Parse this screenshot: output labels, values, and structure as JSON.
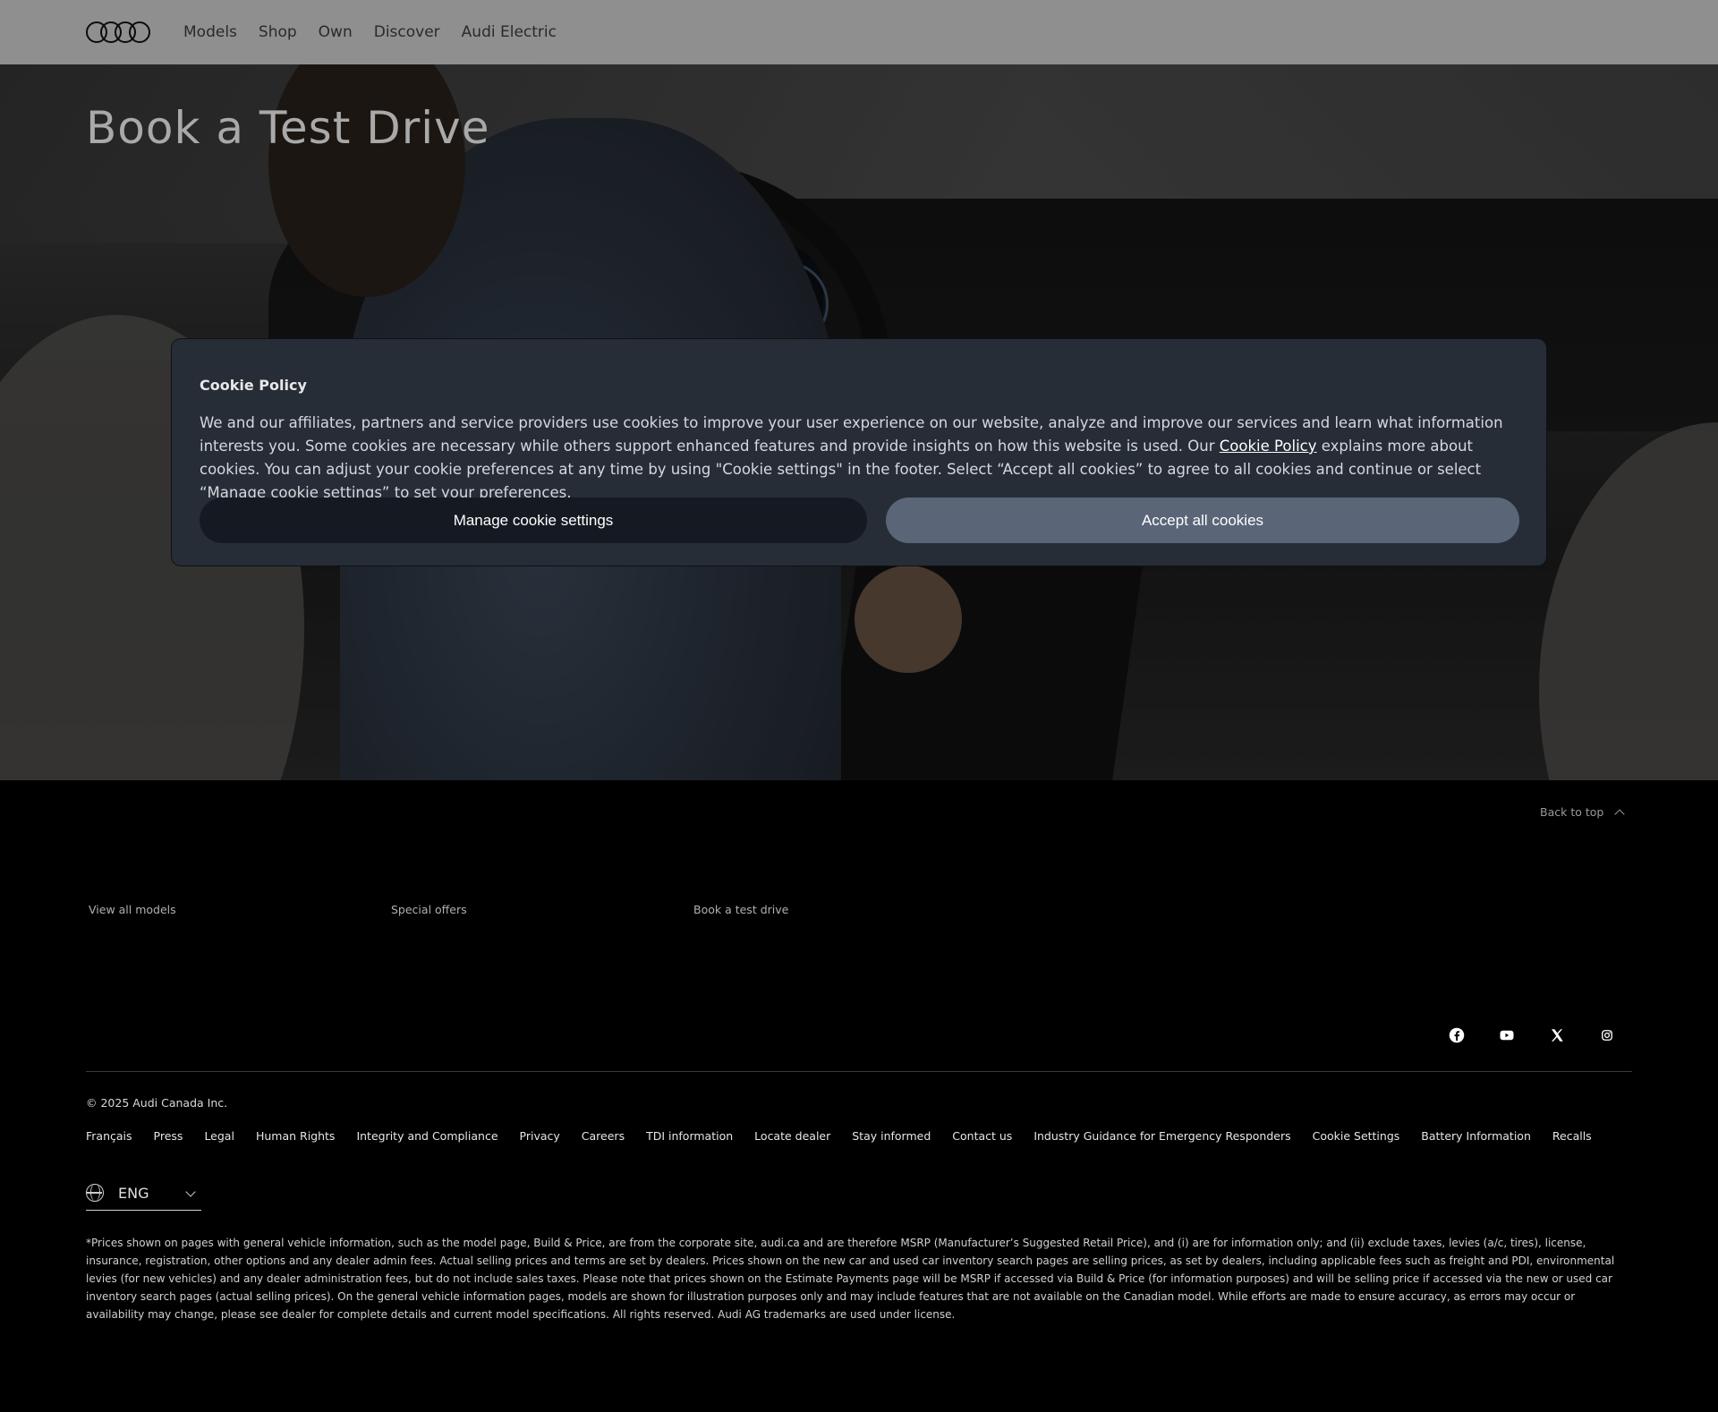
{
  "header": {
    "logo_alt": "Audi",
    "nav": [
      "Models",
      "Shop",
      "Own",
      "Discover",
      "Audi Electric"
    ]
  },
  "hero": {
    "title": "Book a Test Drive"
  },
  "cookie_modal": {
    "title": "Cookie Policy",
    "body_before": "We and our affiliates, partners and service providers use cookies to improve your user experience on our website, analyze and improve our services and learn what information interests you. Some cookies are necessary while others support enhanced features and provide insights on how this website is used. Our ",
    "link": "Cookie Policy",
    "body_after": " explains more about cookies. You can adjust your cookie preferences at any time by using \"Cookie settings\" in the footer. Select “Accept all cookies” to agree to all cookies and continue or select “Manage cookie settings” to set your preferences.",
    "manage_label": "Manage cookie settings",
    "accept_label": "Accept all cookies"
  },
  "footer": {
    "back_to_top": "Back to top",
    "quick_links": [
      "View all models",
      "Special offers",
      "Book a test drive"
    ],
    "social_icons": [
      "facebook-icon",
      "youtube-icon",
      "x-icon",
      "instagram-icon"
    ],
    "copyright": "© 2025 Audi Canada Inc.",
    "links": [
      "Français",
      "Press",
      "Legal",
      "Human Rights",
      "Integrity and Compliance",
      "Privacy",
      "Careers",
      "TDI information",
      "Locate dealer",
      "Stay informed",
      "Contact us",
      "Industry Guidance for Emergency Responders",
      "Cookie Settings",
      "Battery Information",
      "Recalls"
    ],
    "language": "ENG",
    "disclaimer": "*Prices shown on pages with general vehicle information, such as the model page, Build & Price, are from the corporate site, audi.ca and are therefore MSRP (Manufacturer’s Suggested Retail Price), and (i) are for information only; and (ii) exclude taxes, levies (a/c, tires), license, insurance, registration, other options and any dealer admin fees. Actual selling prices and terms are set by dealers. Prices shown on the new car and used car inventory search pages are selling prices, as set by dealers, including applicable fees such as freight and PDI, environmental levies (for new vehicles) and any dealer administration fees, but do not include sales taxes. Please note that prices shown on the Estimate Payments page will be MSRP if accessed via Build & Price (for information purposes) and will be selling price if accessed via the new or used car inventory search pages (actual selling prices). On the general vehicle information pages, models are shown for illustration purposes only and may include features that are not available on the Canadian model. While efforts are made to ensure accuracy, as errors may occur or availability may change, please see dealer for complete details and current model specifications. All rights reserved. Audi AG trademarks are used under license."
  },
  "colors": {
    "header_bg": "#8f8f8f",
    "modal_bg": "#262d37",
    "accept_button": "#5a6578",
    "manage_button": "#151a22",
    "footer_bg": "#000000"
  }
}
